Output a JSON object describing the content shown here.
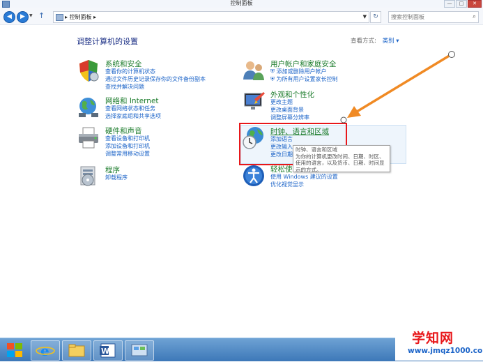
{
  "window": {
    "title": "控制面板"
  },
  "address": {
    "crumb": "控制面板",
    "search_placeholder": "搜索控制面板"
  },
  "heading": "调整计算机的设置",
  "view_by": {
    "label": "查看方式:",
    "value": "类别"
  },
  "categories_left": [
    {
      "title": "系统和安全",
      "icon": "shield-icon",
      "links": [
        "查看你的计算机状态",
        "通过文件历史记录保存你的文件备份副本",
        "查找并解决问题"
      ]
    },
    {
      "title": "网络和 Internet",
      "icon": "network-globe-icon",
      "links": [
        "查看网络状态和任务",
        "选择家庭组和共享选项"
      ]
    },
    {
      "title": "硬件和声音",
      "icon": "printer-icon",
      "links": [
        "查看设备和打印机",
        "添加设备和打印机",
        "调整常用移动设置"
      ]
    },
    {
      "title": "程序",
      "icon": "programs-icon",
      "links": [
        "卸载程序"
      ]
    }
  ],
  "categories_right": [
    {
      "title": "用户帐户和家庭安全",
      "icon": "users-icon",
      "links": [
        "添加或删除用户帐户",
        "为所有用户设置家长控制"
      ]
    },
    {
      "title": "外观和个性化",
      "icon": "display-icon",
      "links": [
        "更改主题",
        "更改桌面背景",
        "调整屏幕分辨率"
      ]
    },
    {
      "title": "时钟、语言和区域",
      "icon": "clock-globe-icon",
      "links": [
        "添加语言",
        "更改输入",
        "更改日期"
      ]
    },
    {
      "title": "轻松使",
      "icon": "ease-of-access-icon",
      "links": [
        "使用 Windows 建议的设置",
        "优化视觉显示"
      ]
    }
  ],
  "tooltip": "时钟、语言和区域\n为你的计算机更改时间、日期、时区、使用的语言，以及货币、日期、时间显示的方式。",
  "watermark": {
    "text": "学知网",
    "url": "www.jmqz1000.com"
  },
  "taskbar": {
    "buttons": [
      "ie-icon",
      "explorer-icon",
      "word-icon",
      "control-panel-icon"
    ]
  },
  "colors": {
    "link": "#1c64c8",
    "category_title": "#1c7c2c",
    "heading": "#1e3287",
    "highlight_box": "#e8171a",
    "arrow": "#f08a24"
  }
}
